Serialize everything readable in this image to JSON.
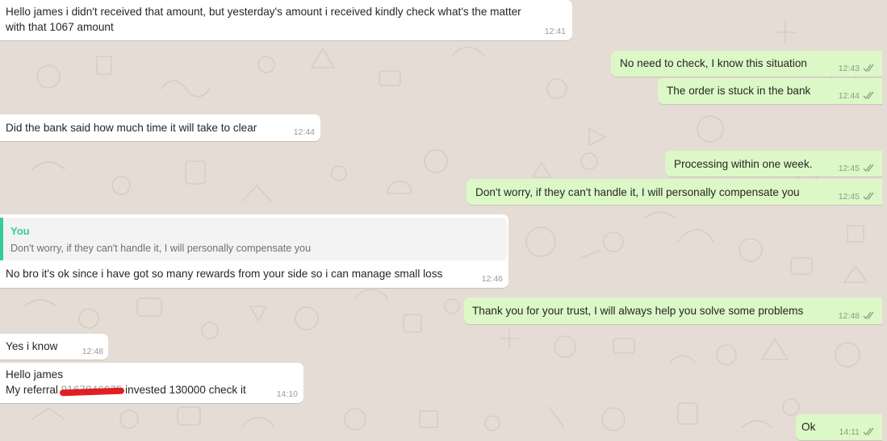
{
  "colors": {
    "wallpaper": "#e5ddd5",
    "incoming_bubble": "#ffffff",
    "outgoing_bubble": "#dcf8c6",
    "quote_accent": "#35cd96",
    "read_ticks": "#8c9a8a",
    "redaction": "#e02020"
  },
  "icons": {
    "delivery": "double-check-icon"
  },
  "messages": [
    {
      "direction": "incoming",
      "lines": [
        "Hello james i didn't received that amount, but yesterday's amount i received kindly check what's the matter",
        "with that 1067 amount"
      ],
      "time": "12:41"
    },
    {
      "direction": "outgoing",
      "text": "No need to check, I know this situation",
      "time": "12:43"
    },
    {
      "direction": "outgoing",
      "text": "The order is stuck in the bank",
      "time": "12:44"
    },
    {
      "direction": "incoming",
      "text": "Did the bank said how much time it will take to clear",
      "time": "12:44"
    },
    {
      "direction": "outgoing",
      "text": "Processing within one week.",
      "time": "12:45"
    },
    {
      "direction": "outgoing",
      "text": "Don't worry, if they can't handle it, I will personally compensate you",
      "time": "12:45"
    },
    {
      "direction": "incoming",
      "quote": {
        "author": "You",
        "text": "Don't worry, if they can't handle it, I will personally compensate you"
      },
      "text": "No bro it's ok since i have got so many rewards from your side so i can manage small loss",
      "time": "12:46"
    },
    {
      "direction": "outgoing",
      "text": "Thank you for your trust, I will always help you solve some problems",
      "time": "12:48"
    },
    {
      "direction": "incoming",
      "text": "Yes i know",
      "time": "12:48"
    },
    {
      "direction": "incoming",
      "line1": "Hello james",
      "line2_before": "My referral ",
      "line2_redacted": "9167846675",
      "line2_after": " invested 130000 check it",
      "time": "14:10"
    },
    {
      "direction": "outgoing",
      "text": "Ok",
      "time": "14:11"
    }
  ]
}
